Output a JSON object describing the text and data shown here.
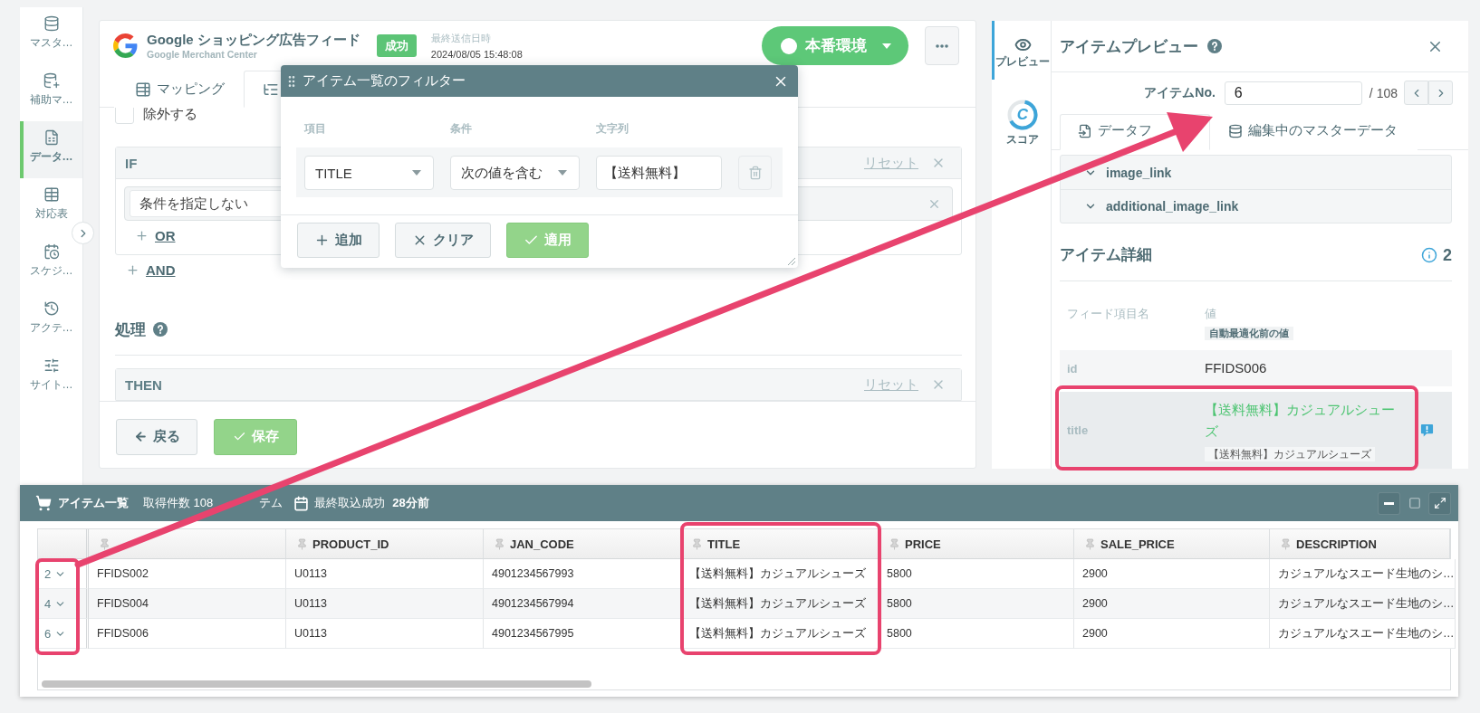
{
  "sidebar": {
    "items": [
      {
        "label": "マスタ…",
        "selected": false
      },
      {
        "label": "補助マ…",
        "selected": false
      },
      {
        "label": "データ…",
        "selected": true
      },
      {
        "label": "対応表",
        "selected": false
      },
      {
        "label": "スケジ…",
        "selected": false
      },
      {
        "label": "アクテ…",
        "selected": false
      },
      {
        "label": "サイト…",
        "selected": false
      }
    ]
  },
  "feed": {
    "title": "Google ショッピング広告フィード",
    "subtitle": "Google Merchant Center",
    "status": "成功",
    "last_sent_label": "最終送信日時",
    "last_sent": "2024/08/05 15:48:08",
    "environment": "本番環境"
  },
  "editor": {
    "tabs": [
      {
        "label": "マッピング",
        "selected": false
      },
      {
        "selected": true
      }
    ],
    "exclude": {
      "label": "除外する",
      "checked": false
    },
    "if_block": {
      "heading": "IF",
      "reset": "リセット",
      "condition": "条件を指定しない",
      "or_link": "OR"
    },
    "and_link": "AND",
    "processing": {
      "heading": "処理"
    },
    "then_block": {
      "heading": "THEN",
      "reset": "リセット"
    },
    "buttons": [
      {
        "kind": "back",
        "label": "戻る"
      },
      {
        "kind": "save",
        "label": "保存"
      }
    ]
  },
  "filter_dialog": {
    "title": "アイテム一覧のフィルター",
    "columns": [
      "項目",
      "条件",
      "文字列"
    ],
    "rows": [
      {
        "field": "TITLE",
        "operator": "次の値を含む",
        "value": "【送料無料】"
      }
    ],
    "buttons": [
      {
        "kind": "add",
        "label": "追加"
      },
      {
        "kind": "clear",
        "label": "クリア"
      },
      {
        "kind": "apply",
        "label": "適用"
      }
    ]
  },
  "side_tabs": [
    {
      "kind": "preview",
      "label": "プレビュー",
      "selected": true
    },
    {
      "kind": "score",
      "label": "スコア",
      "selected": false,
      "grade": "C"
    }
  ],
  "preview": {
    "title": "アイテムプレビュー",
    "item_no_label": "アイテムNo.",
    "item_no": "6",
    "item_total": "/ 108",
    "tabs": [
      {
        "label": "データフ",
        "selected": true
      },
      {
        "label": "編集中のマスターデータ",
        "selected": false
      }
    ],
    "fields": [
      "image_link",
      "additional_image_link"
    ],
    "details": {
      "heading": "アイテム詳細",
      "info_count": "2",
      "name_column": "フィード項目名",
      "value_column": "値",
      "original_note": "自動最適化前の値",
      "rows": [
        {
          "name": "id",
          "value": "FFIDS006",
          "selected": false
        },
        {
          "name": "title",
          "value": "【送料無料】カジュアルシューズ",
          "original": "【送料無料】カジュアルシューズ",
          "selected": true
        }
      ]
    }
  },
  "item_list": {
    "title": "アイテム一覧",
    "count_start": "取得件数 108",
    "count_end": "テム",
    "last_import_label": "最終取込成功",
    "last_import": "28分前",
    "window_controls": [
      {
        "kind": "minimize",
        "disabled": false
      },
      {
        "kind": "maximize",
        "disabled": true
      },
      {
        "kind": "fullscreen",
        "disabled": false
      }
    ],
    "columns": [
      "",
      "PRODUCT_ID",
      "JAN_CODE",
      "TITLE",
      "PRICE",
      "SALE_PRICE",
      "DESCRIPTION"
    ],
    "rows": [
      {
        "number": "2",
        "cells": [
          "FFIDS002",
          "U0113",
          "4901234567993",
          "【送料無料】カジュアルシューズ",
          "5800",
          "2900",
          "カジュアルなスエード生地のシ…"
        ]
      },
      {
        "number": "4",
        "cells": [
          "FFIDS004",
          "U0113",
          "4901234567994",
          "【送料無料】カジュアルシューズ",
          "5800",
          "2900",
          "カジュアルなスエード生地のシ…"
        ]
      },
      {
        "number": "6",
        "cells": [
          "FFIDS006",
          "U0113",
          "4901234567995",
          "【送料無料】カジュアルシューズ",
          "5800",
          "2900",
          "カジュアルなスエード生地のシ…"
        ]
      }
    ]
  }
}
